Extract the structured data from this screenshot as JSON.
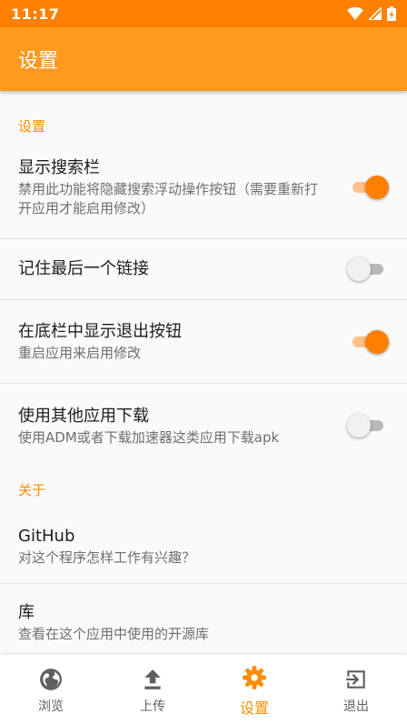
{
  "status_bar": {
    "time": "11:17"
  },
  "app_bar": {
    "title": "设置"
  },
  "sections": [
    {
      "category": "设置",
      "items": [
        {
          "title": "显示搜索栏",
          "summary": "禁用此功能将隐藏搜索浮动操作按钮（需要重新打开应用才能启用修改）",
          "switch": true
        },
        {
          "title": "记住最后一个链接",
          "summary": "",
          "switch": false
        },
        {
          "title": "在底栏中显示退出按钮",
          "summary": "重启应用来启用修改",
          "switch": true
        },
        {
          "title": "使用其他应用下载",
          "summary": "使用ADM或者下载加速器这类应用下载apk",
          "switch": false
        }
      ]
    },
    {
      "category": "关于",
      "items": [
        {
          "title": "GitHub",
          "summary": "对这个程序怎样工作有兴趣？"
        },
        {
          "title": "库",
          "summary": "查看在这个应用中使用的开源库"
        }
      ]
    }
  ],
  "bottom_nav": [
    {
      "label": "浏览",
      "icon": "globe-icon",
      "active": false
    },
    {
      "label": "上传",
      "icon": "upload-icon",
      "active": false
    },
    {
      "label": "设置",
      "icon": "gear-icon",
      "active": true
    },
    {
      "label": "退出",
      "icon": "exit-icon",
      "active": false
    }
  ],
  "colors": {
    "status_bar": "#ff7f00",
    "app_bar": "#ff9a1f",
    "accent": "#ff8c00",
    "switch_off_track": "#b9b9b9"
  }
}
